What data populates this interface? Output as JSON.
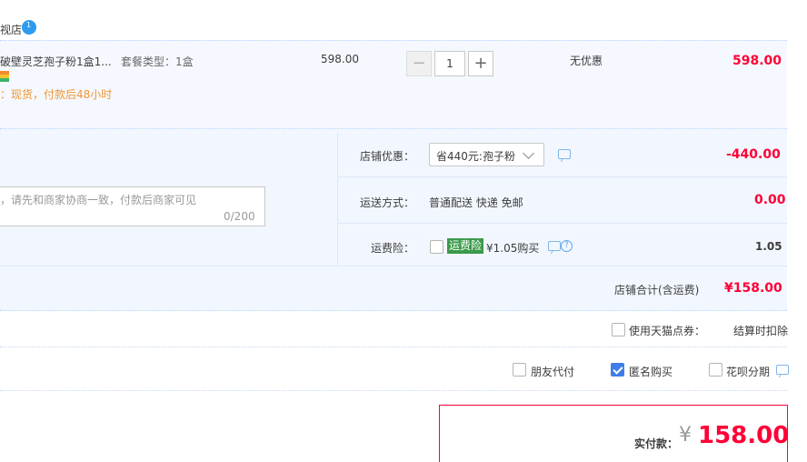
{
  "shop": {
    "name": "视店"
  },
  "item": {
    "title": "破壁灵芝孢子粉1盒1...",
    "sku": "套餐类型：1盒",
    "unit_price": "598.00",
    "quantity": "1",
    "discount": "无优惠",
    "subtotal": "598.00",
    "stock_note": "：现货，付款后48小时"
  },
  "order": {
    "memo_placeholder": "，请先和商家协商一致，付款后商家可见",
    "memo_counter": "0/200",
    "shop_discount_label": "店铺优惠：",
    "shop_discount_option": "省440元:孢子粉",
    "shop_discount_amount": "-440.00",
    "shipping_label": "运送方式：",
    "shipping_value": "普通配送 快递 免邮",
    "shipping_amount": "0.00",
    "insurance_label": "运费险：",
    "insurance_badge": "运费险",
    "insurance_price": "¥1.05购买",
    "insurance_amount": "1.05",
    "shop_total_label": "店铺合计(含运费)",
    "shop_total_amount": "¥158.00"
  },
  "coupon": {
    "label": "使用天猫点券：",
    "note": "结算时扣除"
  },
  "options": {
    "friend_pay": "朋友代付",
    "anonymous": "匿名购买",
    "installment": "花呗分期"
  },
  "payment": {
    "label": "实付款：",
    "currency": "¥",
    "amount": "158.00"
  },
  "colors": {
    "accent_red": "#ff0036",
    "panel_blue": "#f2f7ff",
    "check_blue": "#3f7ee8",
    "insure_green": "#3a9a4a"
  }
}
